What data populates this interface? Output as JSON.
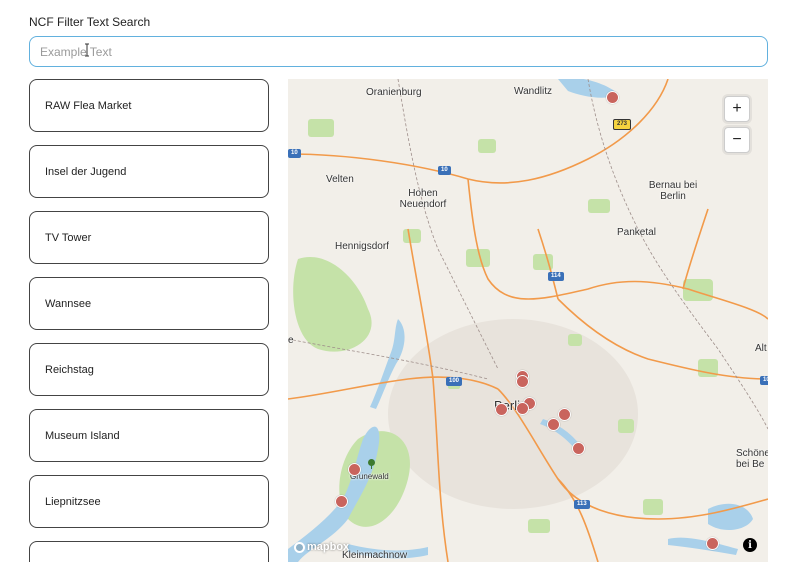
{
  "search": {
    "label": "NCF Filter Text Search",
    "placeholder": "Example Text",
    "value": ""
  },
  "locations": [
    "RAW Flea Market",
    "Insel der Jugend",
    "TV Tower",
    "Wannsee",
    "Reichstag",
    "Museum Island",
    "Liepnitzsee",
    ""
  ],
  "map": {
    "place_labels": [
      "Oranienburg",
      "Wandlitz",
      "Velten",
      "Hohen Neuendorf",
      "Bernau bei Berlin",
      "Hennigsdorf",
      "Panketal",
      "Alt",
      "Schöne bei Be",
      "Berlin",
      "Grunewald",
      "Kleinmachnow",
      "e"
    ],
    "road_shields": [
      "273",
      "10",
      "114",
      "100",
      "113",
      "10",
      "10"
    ],
    "zoom_in": "+",
    "zoom_out": "−",
    "attribution_logo": "mapbox",
    "info": "i",
    "colors": {
      "water": "#a9d0ea",
      "park": "#bfdfa1",
      "highway": "#f29a4a",
      "land": "#f2efe9",
      "marker": "#c9645d"
    }
  }
}
